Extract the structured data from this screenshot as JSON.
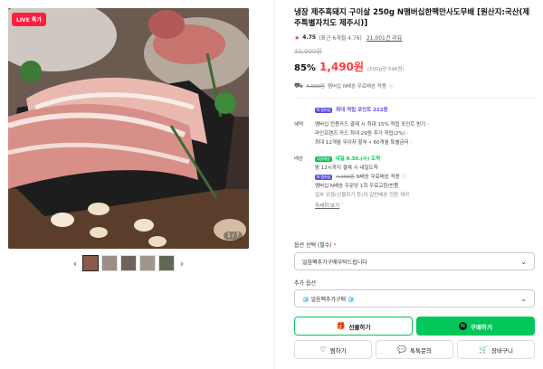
{
  "gallery": {
    "live_badge": "LIVE 특가",
    "counter": "1 / 7",
    "prev_arrow": "‹",
    "next_arrow": "›",
    "thumb_count": 5
  },
  "product": {
    "title": "냉장 제주흑돼지 구이살 250g N맴버십한팩만사도무배 [원산지:국산(제주특별자치도 제주시)]",
    "rating": "4.75",
    "rating_note": "(최근 6개월 4.76)",
    "review_text": "21,001건 리뷰",
    "original_price": "10,000원",
    "discount": "85%",
    "price": "1,490원",
    "unit_price": "(100g당 596원)",
    "shipping_summary_strike": "4,000원",
    "shipping_summary_rest": "멤버십 N배송 무료배송 적용"
  },
  "benefits": {
    "point_label": "N 멤버십",
    "point_text": "최대 적립 포인트",
    "point_value": "222원",
    "label": "혜택",
    "line1": "멤버십 전용카드 결제 시 최대 15% 적립 포인트 받기",
    "line2": "라인프렌즈 카드 최대 29원 추가 적립(2%)",
    "line3": "최대 12개월 무이자 할부 • 60개월 특별금리"
  },
  "delivery": {
    "label": "배송",
    "badge": "내일배송",
    "arrival": "내일 9.30.(수) 도착",
    "cutoff": "밤 12시까지 결제 시 내일도착",
    "npay_label": "N 멤버십",
    "strike": "4,000원",
    "free_text": "N배송 무료배송 적용",
    "line3": "멤버십 N배송 주문당 1회 무료교환/반품",
    "line4": "일부 유형(선물하기 등)외 일반배송 전환 제외",
    "detail": "자세히 보기"
  },
  "option": {
    "label": "옵션 선택 (필수)",
    "required_mark": "*",
    "value": "얼음팩추가구매부탁드립니다",
    "extra_label": "추가 옵션",
    "extra_value": "얼음팩추가구매"
  },
  "buttons": {
    "gift": "선물하기",
    "buy": "구매하기",
    "wish": "찜하기",
    "talk": "톡톡문의",
    "cart": "장바구니"
  },
  "colors": {
    "accent_red": "#ff3b3b",
    "naver_green": "#03c75a",
    "membership_purple": "#5a4fe0"
  }
}
